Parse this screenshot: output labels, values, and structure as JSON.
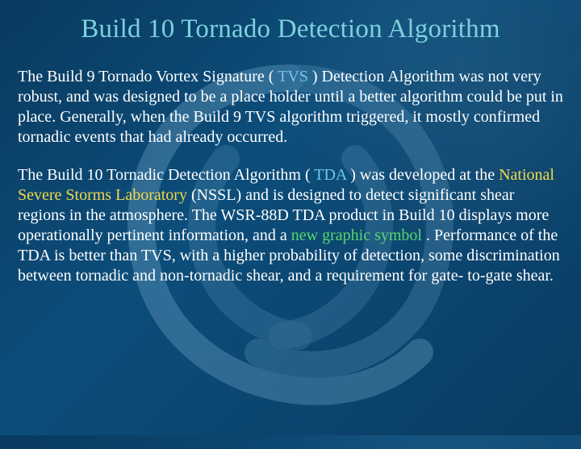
{
  "title": "Build 10 Tornado Detection Algorithm",
  "p1": {
    "a": "The Build 9 Tornado Vortex Signature ( ",
    "tvs": "TVS",
    "b": " ) Detection Algorithm was not very robust, and was designed to be a place holder until a better algorithm could be put in place.  Generally, when the Build 9 TVS algorithm triggered, it mostly confirmed tornadic events that had already occurred."
  },
  "p2": {
    "a": "The Build 10 Tornadic Detection Algorithm ( ",
    "tda": "TDA",
    "b": " ) was developed at the ",
    "nssl": "National Severe Storms Laboratory",
    "c": " (NSSL) and is designed to detect significant shear regions in the atmosphere.  The WSR-88D TDA product in Build 10 displays more operationally pertinent information, and a ",
    "ngs": "new graphic symbol",
    "d": " .  Performance of the TDA is better than TVS, with a higher probability of detection, some discrimination between tornadic and non-tornadic shear, and a requirement for gate- to-gate shear."
  }
}
